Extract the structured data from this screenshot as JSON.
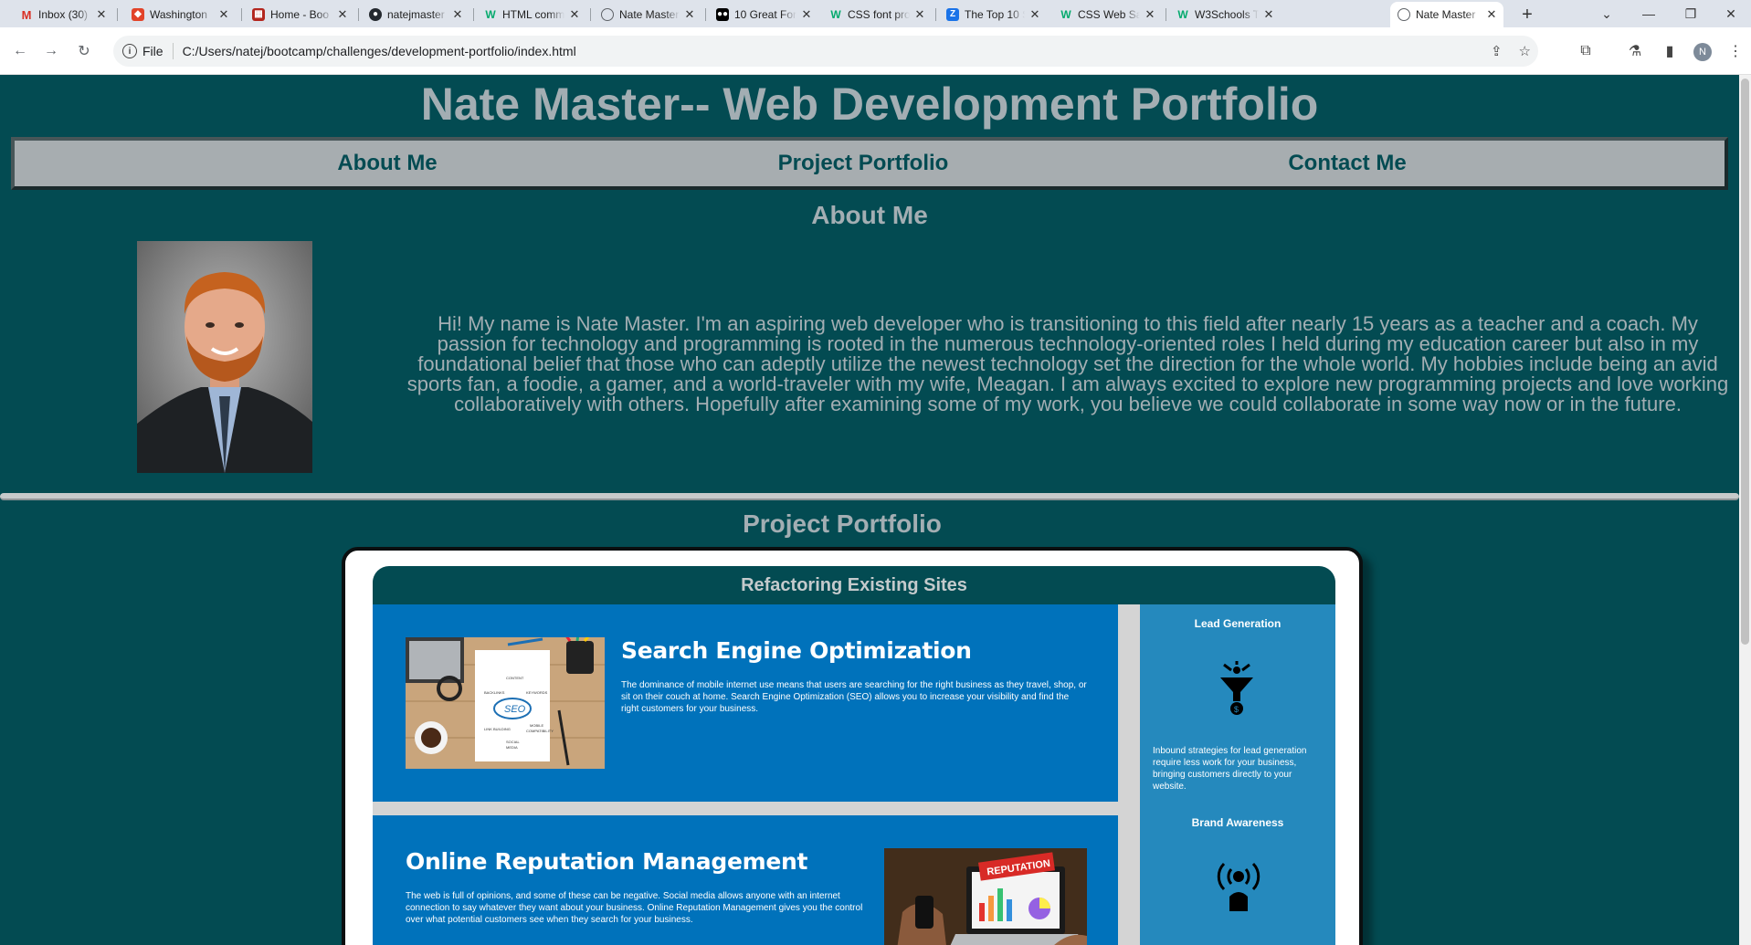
{
  "browser": {
    "tabs": [
      {
        "label": "Inbox (30) -",
        "favicon": "gmail-icon",
        "color": "#d93025"
      },
      {
        "label": "Washington",
        "favicon": "gitlab-icon",
        "color": "#e24329"
      },
      {
        "label": "Home - Boo",
        "favicon": "bootcamp-icon",
        "color": "#b3261e"
      },
      {
        "label": "natejmaster",
        "favicon": "github-icon",
        "color": "#24292f"
      },
      {
        "label": "HTML comm",
        "favicon": "w3schools-icon",
        "color": "#04aa6d"
      },
      {
        "label": "Nate Master",
        "favicon": "globe-icon",
        "color": "#5f6368"
      },
      {
        "label": "10 Great For",
        "favicon": "medium-icon",
        "color": "#000000"
      },
      {
        "label": "CSS font pro",
        "favicon": "w3schools-icon",
        "color": "#04aa6d"
      },
      {
        "label": "The Top 10 S",
        "favicon": "zapier-icon",
        "color": "#1a73e8"
      },
      {
        "label": "CSS Web Saf",
        "favicon": "w3schools-icon",
        "color": "#04aa6d"
      },
      {
        "label": "W3Schools T",
        "favicon": "w3schools-icon",
        "color": "#04aa6d"
      },
      {
        "label": "Nate Master",
        "favicon": "globe-icon",
        "color": "#5f6368",
        "active": true
      }
    ],
    "omnibox": {
      "scheme": "File",
      "url": "C:/Users/natej/bootcamp/challenges/development-portfolio/index.html"
    },
    "profile_initial": "N"
  },
  "page": {
    "title": "Nate Master-- Web Development Portfolio",
    "nav": [
      "About Me",
      "Project Portfolio",
      "Contact Me"
    ],
    "about": {
      "heading": "About Me",
      "text": "Hi! My name is Nate Master. I'm an aspiring web developer who is transitioning to this field after nearly 15 years as a teacher and a coach. My passion for technology and programming is rooted in the numerous technology-oriented roles I held during my education career but also in my foundational belief that those who can adeptly utilize the newest technology set the direction for the whole world. My hobbies include being an avid sports fan, a foodie, a gamer, and a world-traveler with my wife, Meagan. I am always excited to explore new programming projects and love working collaboratively with others. Hopefully after examining some of my work, you believe we could collaborate in some way now or in the future."
    },
    "portfolio": {
      "heading": "Project Portfolio",
      "project_title": "Refactoring Existing Sites",
      "cards": [
        {
          "title": "Search Engine Optimization",
          "text": "The dominance of mobile internet use means that users are searching for the right business as they travel, shop, or sit on their couch at home. Search Engine Optimization (SEO) allows you to increase your visibility and find the right customers for your business.",
          "image_words": [
            "CONTENT",
            "BACKLINKS",
            "KEYWORDS",
            "SEO",
            "MOBILE",
            "COMPATIBILITY",
            "LINK BUILDING",
            "SOCIAL",
            "MEDIA"
          ]
        },
        {
          "title": "Online Reputation Management",
          "text": "The web is full of opinions, and some of these can be negative. Social media allows anyone with an internet connection to say whatever they want about your business. Online Reputation Management gives you the control over what potential customers see when they search for your business.",
          "image_word": "REPUTATION"
        }
      ],
      "sidebar": [
        {
          "heading": "Lead Generation",
          "icon": "funnel-icon",
          "text": "Inbound strategies for lead generation require less work for your business, bringing customers directly to your website."
        },
        {
          "heading": "Brand Awareness",
          "icon": "broadcast-person-icon"
        }
      ]
    }
  },
  "colors": {
    "page_bg": "#034b52",
    "title_text": "#a3aeb3",
    "nav_bg": "#a7adb0",
    "card_blue": "#0072bb",
    "sidebar_blue": "#2589bd"
  }
}
